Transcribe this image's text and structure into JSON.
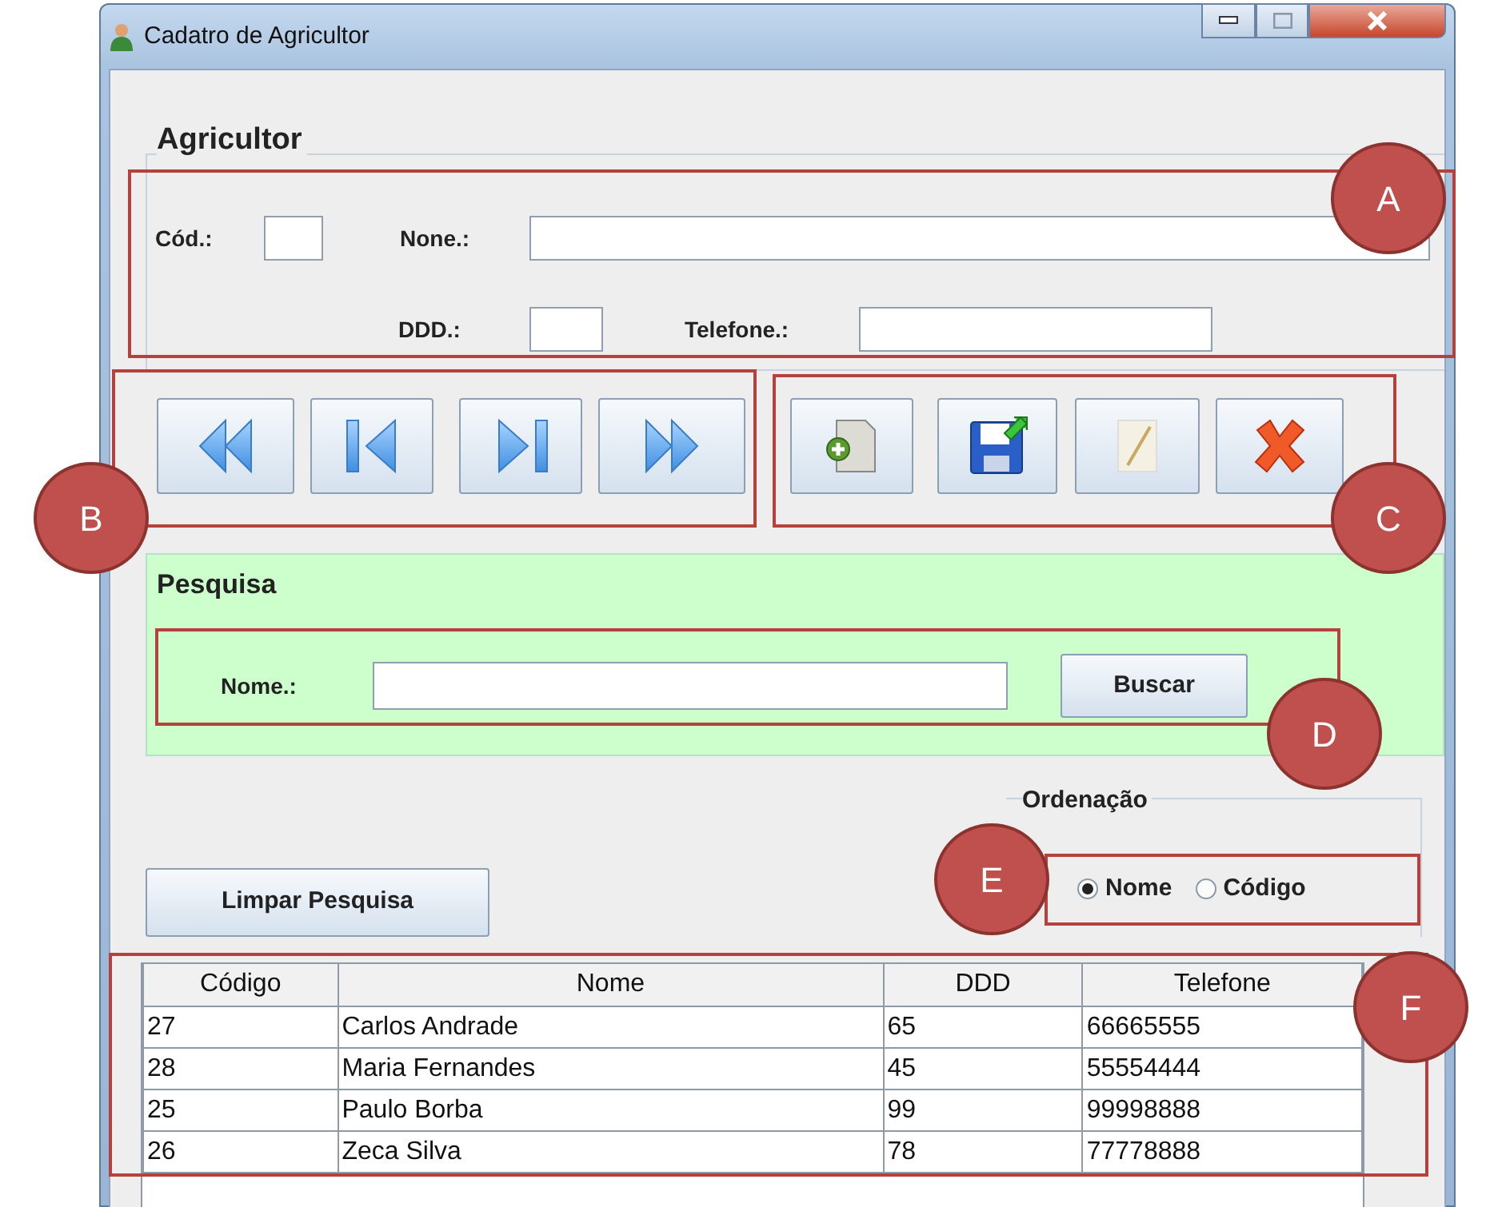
{
  "window": {
    "title": "Cadatro de Agricultor"
  },
  "agricultor": {
    "title": "Agricultor",
    "fields": [
      {
        "label": "Cód.:"
      },
      {
        "label": "None.:"
      },
      {
        "label": "DDD.:"
      },
      {
        "label": "Telefone.:"
      }
    ]
  },
  "nav_buttons": [
    {
      "kind": "first"
    },
    {
      "kind": "previous"
    },
    {
      "kind": "next"
    },
    {
      "kind": "last"
    }
  ],
  "action_buttons": [
    {
      "kind": "new"
    },
    {
      "kind": "save"
    },
    {
      "kind": "edit"
    },
    {
      "kind": "delete"
    }
  ],
  "pesquisa": {
    "title": "Pesquisa",
    "label": "Nome.:",
    "button": "Buscar"
  },
  "ordenacao": {
    "title": "Ordenação",
    "options": [
      {
        "label": "Nome",
        "selected": true
      },
      {
        "label": "Código",
        "selected": false
      }
    ]
  },
  "clear_button": "Limpar Pesquisa",
  "table": {
    "columns": [
      "Código",
      "Nome",
      "DDD",
      "Telefone"
    ],
    "rows": [
      [
        "27",
        "Carlos Andrade",
        "65",
        "66665555"
      ],
      [
        "28",
        "Maria Fernandes",
        "45",
        "55554444"
      ],
      [
        "25",
        "Paulo Borba",
        "99",
        "99998888"
      ],
      [
        "26",
        "Zeca Silva",
        "78",
        "77778888"
      ]
    ]
  },
  "annotations": [
    {
      "label": "A"
    },
    {
      "label": "B"
    },
    {
      "label": "C"
    },
    {
      "label": "D"
    },
    {
      "label": "E"
    },
    {
      "label": "F"
    }
  ]
}
